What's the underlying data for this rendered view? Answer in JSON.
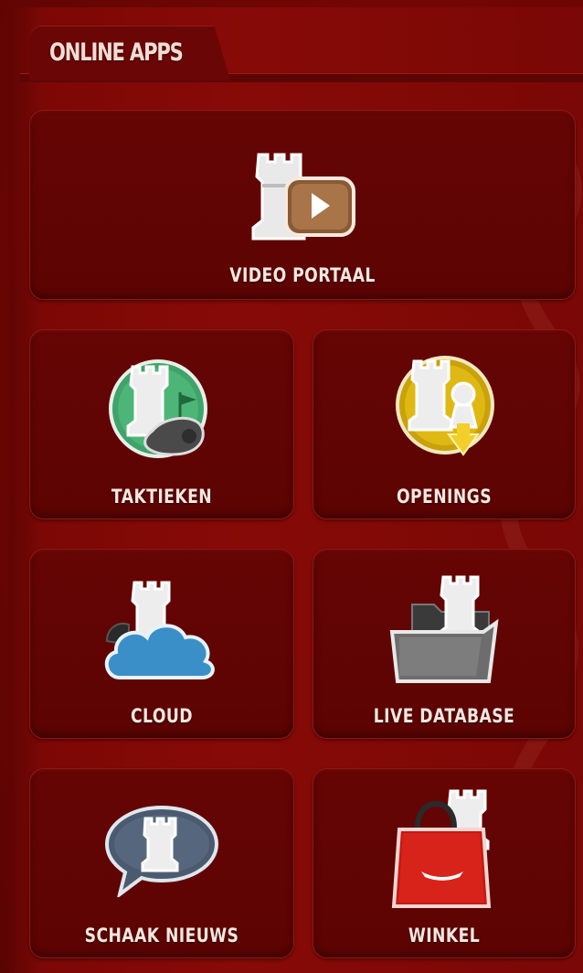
{
  "section": {
    "title": "ONLINE APPS"
  },
  "apps": [
    {
      "label": "VIDEO PORTAAL",
      "icon": "video-play-icon"
    },
    {
      "label": "TAKTIEKEN",
      "icon": "whistle-flag-icon"
    },
    {
      "label": "OPENINGS",
      "icon": "opening-download-icon"
    },
    {
      "label": "CLOUD",
      "icon": "cloud-icon"
    },
    {
      "label": "LIVE DATABASE",
      "icon": "folder-icon"
    },
    {
      "label": "SCHAAK NIEUWS",
      "icon": "speech-bubble-icon"
    },
    {
      "label": "WINKEL",
      "icon": "shopping-bag-icon"
    }
  ],
  "colors": {
    "background": "#7c0806",
    "tile": "#5e0403",
    "text": "#f6e6df"
  }
}
